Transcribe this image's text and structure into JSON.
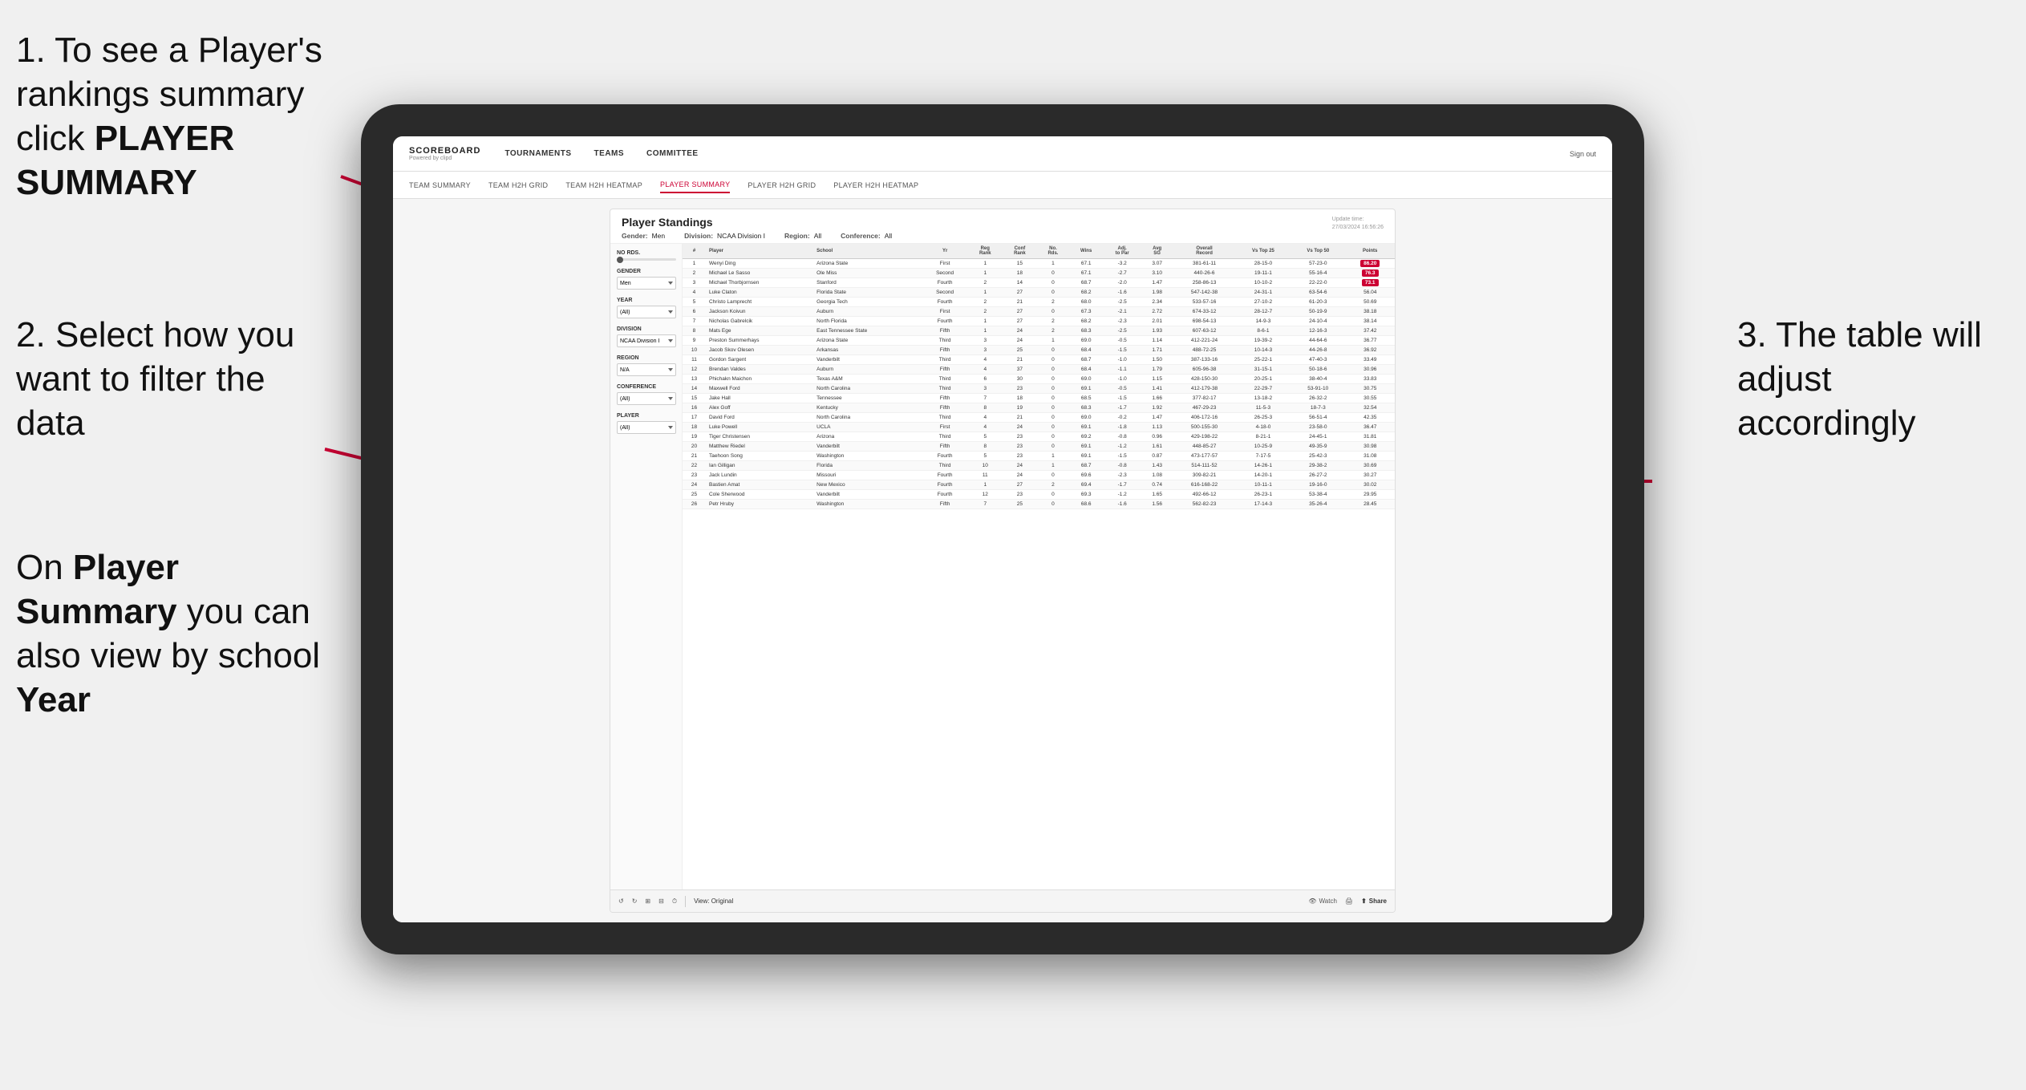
{
  "annotations": {
    "top_left": {
      "number": "1.",
      "text": "To see a Player's rankings summary click ",
      "bold_text": "PLAYER SUMMARY"
    },
    "mid_left": {
      "number": "2.",
      "text": "Select how you want to filter the data"
    },
    "bottom_left": {
      "prefix": "On ",
      "bold1": "Player Summary",
      "middle": " you can also view by school ",
      "bold2": "Year"
    },
    "right": {
      "number": "3.",
      "text": "The table will adjust accordingly"
    }
  },
  "app": {
    "logo": "SCOREBOARD",
    "logo_sub": "Powered by clipd",
    "nav": [
      "TOURNAMENTS",
      "TEAMS",
      "COMMITTEE"
    ],
    "nav_sign_out": "Sign out",
    "sub_nav": [
      "TEAM SUMMARY",
      "TEAM H2H GRID",
      "TEAM H2H HEATMAP",
      "PLAYER SUMMARY",
      "PLAYER H2H GRID",
      "PLAYER H2H HEATMAP"
    ],
    "active_sub_nav": "PLAYER SUMMARY"
  },
  "standings": {
    "title": "Player Standings",
    "update_time": "Update time:",
    "update_date": "27/03/2024 16:56:26",
    "filters": {
      "gender_label": "Gender:",
      "gender_value": "Men",
      "division_label": "Division:",
      "division_value": "NCAA Division I",
      "region_label": "Region:",
      "region_value": "All",
      "conference_label": "Conference:",
      "conference_value": "All"
    },
    "left_filters": {
      "no_rds_label": "No Rds.",
      "gender_label": "Gender",
      "gender_value": "Men",
      "year_label": "Year",
      "year_value": "(All)",
      "division_label": "Division",
      "division_value": "NCAA Division I",
      "region_label": "Region",
      "region_value": "N/A",
      "conference_label": "Conference",
      "conference_value": "(All)",
      "player_label": "Player",
      "player_value": "(All)"
    },
    "table_headers": [
      "#",
      "Player",
      "School",
      "Yr",
      "Reg Rank",
      "Conf Rank",
      "No. Rds.",
      "Wins",
      "Adj. to Par",
      "Avg SG",
      "Overall Record",
      "Vs Top 25",
      "Vs Top 50",
      "Points"
    ],
    "rows": [
      {
        "rank": "1",
        "player": "Wenyi Ding",
        "school": "Arizona State",
        "yr": "First",
        "reg_rank": "1",
        "conf_rank": "15",
        "rds": "1",
        "wins": "67.1",
        "adj": "-3.2",
        "avg_sg": "3.07",
        "overall": "381-61-11",
        "vs25": "28-15-0",
        "vs50": "57-23-0",
        "points": "86.20"
      },
      {
        "rank": "2",
        "player": "Michael Le Sasso",
        "school": "Ole Miss",
        "yr": "Second",
        "reg_rank": "1",
        "conf_rank": "18",
        "rds": "0",
        "wins": "67.1",
        "adj": "-2.7",
        "avg_sg": "3.10",
        "overall": "440-26-6",
        "vs25": "19-11-1",
        "vs50": "55-16-4",
        "points": "76.3"
      },
      {
        "rank": "3",
        "player": "Michael Thorbjornsen",
        "school": "Stanford",
        "yr": "Fourth",
        "reg_rank": "2",
        "conf_rank": "14",
        "rds": "0",
        "wins": "68.7",
        "adj": "-2.0",
        "avg_sg": "1.47",
        "overall": "258-86-13",
        "vs25": "10-10-2",
        "vs50": "22-22-0",
        "points": "73.1"
      },
      {
        "rank": "4",
        "player": "Luke Claton",
        "school": "Florida State",
        "yr": "Second",
        "reg_rank": "1",
        "conf_rank": "27",
        "rds": "0",
        "wins": "68.2",
        "adj": "-1.6",
        "avg_sg": "1.98",
        "overall": "547-142-38",
        "vs25": "24-31-1",
        "vs50": "63-54-6",
        "points": "56.04"
      },
      {
        "rank": "5",
        "player": "Christo Lamprecht",
        "school": "Georgia Tech",
        "yr": "Fourth",
        "reg_rank": "2",
        "conf_rank": "21",
        "rds": "2",
        "wins": "68.0",
        "adj": "-2.5",
        "avg_sg": "2.34",
        "overall": "533-57-16",
        "vs25": "27-10-2",
        "vs50": "61-20-3",
        "points": "50.69"
      },
      {
        "rank": "6",
        "player": "Jackson Koivun",
        "school": "Auburn",
        "yr": "First",
        "reg_rank": "2",
        "conf_rank": "27",
        "rds": "0",
        "wins": "67.3",
        "adj": "-2.1",
        "avg_sg": "2.72",
        "overall": "674-33-12",
        "vs25": "28-12-7",
        "vs50": "50-19-9",
        "points": "38.18"
      },
      {
        "rank": "7",
        "player": "Nicholas Gabrelcik",
        "school": "North Florida",
        "yr": "Fourth",
        "reg_rank": "1",
        "conf_rank": "27",
        "rds": "2",
        "wins": "68.2",
        "adj": "-2.3",
        "avg_sg": "2.01",
        "overall": "698-54-13",
        "vs25": "14-9-3",
        "vs50": "24-10-4",
        "points": "38.14"
      },
      {
        "rank": "8",
        "player": "Mats Ege",
        "school": "East Tennessee State",
        "yr": "Fifth",
        "reg_rank": "1",
        "conf_rank": "24",
        "rds": "2",
        "wins": "68.3",
        "adj": "-2.5",
        "avg_sg": "1.93",
        "overall": "607-63-12",
        "vs25": "8-6-1",
        "vs50": "12-16-3",
        "points": "37.42"
      },
      {
        "rank": "9",
        "player": "Preston Summerhays",
        "school": "Arizona State",
        "yr": "Third",
        "reg_rank": "3",
        "conf_rank": "24",
        "rds": "1",
        "wins": "69.0",
        "adj": "-0.5",
        "avg_sg": "1.14",
        "overall": "412-221-24",
        "vs25": "19-39-2",
        "vs50": "44-64-6",
        "points": "36.77"
      },
      {
        "rank": "10",
        "player": "Jacob Skov Olesen",
        "school": "Arkansas",
        "yr": "Fifth",
        "reg_rank": "3",
        "conf_rank": "25",
        "rds": "0",
        "wins": "68.4",
        "adj": "-1.5",
        "avg_sg": "1.71",
        "overall": "488-72-25",
        "vs25": "10-14-3",
        "vs50": "44-26-8",
        "points": "36.92"
      },
      {
        "rank": "11",
        "player": "Gordon Sargent",
        "school": "Vanderbilt",
        "yr": "Third",
        "reg_rank": "4",
        "conf_rank": "21",
        "rds": "0",
        "wins": "68.7",
        "adj": "-1.0",
        "avg_sg": "1.50",
        "overall": "387-133-16",
        "vs25": "25-22-1",
        "vs50": "47-40-3",
        "points": "33.49"
      },
      {
        "rank": "12",
        "player": "Brendan Valdes",
        "school": "Auburn",
        "yr": "Fifth",
        "reg_rank": "4",
        "conf_rank": "37",
        "rds": "0",
        "wins": "68.4",
        "adj": "-1.1",
        "avg_sg": "1.79",
        "overall": "605-96-38",
        "vs25": "31-15-1",
        "vs50": "50-18-6",
        "points": "30.96"
      },
      {
        "rank": "13",
        "player": "Phichakn Maichon",
        "school": "Texas A&M",
        "yr": "Third",
        "reg_rank": "6",
        "conf_rank": "30",
        "rds": "0",
        "wins": "69.0",
        "adj": "-1.0",
        "avg_sg": "1.15",
        "overall": "428-150-30",
        "vs25": "20-25-1",
        "vs50": "38-40-4",
        "points": "33.83"
      },
      {
        "rank": "14",
        "player": "Maxwell Ford",
        "school": "North Carolina",
        "yr": "Third",
        "reg_rank": "3",
        "conf_rank": "23",
        "rds": "0",
        "wins": "69.1",
        "adj": "-0.5",
        "avg_sg": "1.41",
        "overall": "412-179-38",
        "vs25": "22-29-7",
        "vs50": "53-91-10",
        "points": "30.75"
      },
      {
        "rank": "15",
        "player": "Jake Hall",
        "school": "Tennessee",
        "yr": "Fifth",
        "reg_rank": "7",
        "conf_rank": "18",
        "rds": "0",
        "wins": "68.5",
        "adj": "-1.5",
        "avg_sg": "1.66",
        "overall": "377-82-17",
        "vs25": "13-18-2",
        "vs50": "26-32-2",
        "points": "30.55"
      },
      {
        "rank": "16",
        "player": "Alex Goff",
        "school": "Kentucky",
        "yr": "Fifth",
        "reg_rank": "8",
        "conf_rank": "19",
        "rds": "0",
        "wins": "68.3",
        "adj": "-1.7",
        "avg_sg": "1.92",
        "overall": "467-29-23",
        "vs25": "11-5-3",
        "vs50": "18-7-3",
        "points": "32.54"
      },
      {
        "rank": "17",
        "player": "David Ford",
        "school": "North Carolina",
        "yr": "Third",
        "reg_rank": "4",
        "conf_rank": "21",
        "rds": "0",
        "wins": "69.0",
        "adj": "-0.2",
        "avg_sg": "1.47",
        "overall": "406-172-16",
        "vs25": "26-25-3",
        "vs50": "56-51-4",
        "points": "42.35"
      },
      {
        "rank": "18",
        "player": "Luke Powell",
        "school": "UCLA",
        "yr": "First",
        "reg_rank": "4",
        "conf_rank": "24",
        "rds": "0",
        "wins": "69.1",
        "adj": "-1.8",
        "avg_sg": "1.13",
        "overall": "500-155-30",
        "vs25": "4-18-0",
        "vs50": "23-58-0",
        "points": "36.47"
      },
      {
        "rank": "19",
        "player": "Tiger Christensen",
        "school": "Arizona",
        "yr": "Third",
        "reg_rank": "5",
        "conf_rank": "23",
        "rds": "0",
        "wins": "69.2",
        "adj": "-0.8",
        "avg_sg": "0.96",
        "overall": "429-198-22",
        "vs25": "8-21-1",
        "vs50": "24-45-1",
        "points": "31.81"
      },
      {
        "rank": "20",
        "player": "Matthew Riedel",
        "school": "Vanderbilt",
        "yr": "Fifth",
        "reg_rank": "8",
        "conf_rank": "23",
        "rds": "0",
        "wins": "69.1",
        "adj": "-1.2",
        "avg_sg": "1.61",
        "overall": "448-85-27",
        "vs25": "10-25-9",
        "vs50": "49-35-9",
        "points": "30.98"
      },
      {
        "rank": "21",
        "player": "Taehoon Song",
        "school": "Washington",
        "yr": "Fourth",
        "reg_rank": "5",
        "conf_rank": "23",
        "rds": "1",
        "wins": "69.1",
        "adj": "-1.5",
        "avg_sg": "0.87",
        "overall": "473-177-57",
        "vs25": "7-17-5",
        "vs50": "25-42-3",
        "points": "31.08"
      },
      {
        "rank": "22",
        "player": "Ian Gilligan",
        "school": "Florida",
        "yr": "Third",
        "reg_rank": "10",
        "conf_rank": "24",
        "rds": "1",
        "wins": "68.7",
        "adj": "-0.8",
        "avg_sg": "1.43",
        "overall": "514-111-52",
        "vs25": "14-26-1",
        "vs50": "29-38-2",
        "points": "30.69"
      },
      {
        "rank": "23",
        "player": "Jack Lundin",
        "school": "Missouri",
        "yr": "Fourth",
        "reg_rank": "11",
        "conf_rank": "24",
        "rds": "0",
        "wins": "69.6",
        "adj": "-2.3",
        "avg_sg": "1.08",
        "overall": "309-82-21",
        "vs25": "14-20-1",
        "vs50": "26-27-2",
        "points": "30.27"
      },
      {
        "rank": "24",
        "player": "Bastien Amat",
        "school": "New Mexico",
        "yr": "Fourth",
        "reg_rank": "1",
        "conf_rank": "27",
        "rds": "2",
        "wins": "69.4",
        "adj": "-1.7",
        "avg_sg": "0.74",
        "overall": "616-168-22",
        "vs25": "10-11-1",
        "vs50": "19-16-0",
        "points": "30.02"
      },
      {
        "rank": "25",
        "player": "Cole Sherwood",
        "school": "Vanderbilt",
        "yr": "Fourth",
        "reg_rank": "12",
        "conf_rank": "23",
        "rds": "0",
        "wins": "69.3",
        "adj": "-1.2",
        "avg_sg": "1.65",
        "overall": "492-66-12",
        "vs25": "26-23-1",
        "vs50": "53-38-4",
        "points": "29.95"
      },
      {
        "rank": "26",
        "player": "Petr Hruby",
        "school": "Washington",
        "yr": "Fifth",
        "reg_rank": "7",
        "conf_rank": "25",
        "rds": "0",
        "wins": "68.6",
        "adj": "-1.6",
        "avg_sg": "1.56",
        "overall": "562-82-23",
        "vs25": "17-14-3",
        "vs50": "35-26-4",
        "points": "28.45"
      }
    ]
  },
  "toolbar": {
    "view_label": "View: Original",
    "watch_label": "Watch",
    "share_label": "Share"
  }
}
